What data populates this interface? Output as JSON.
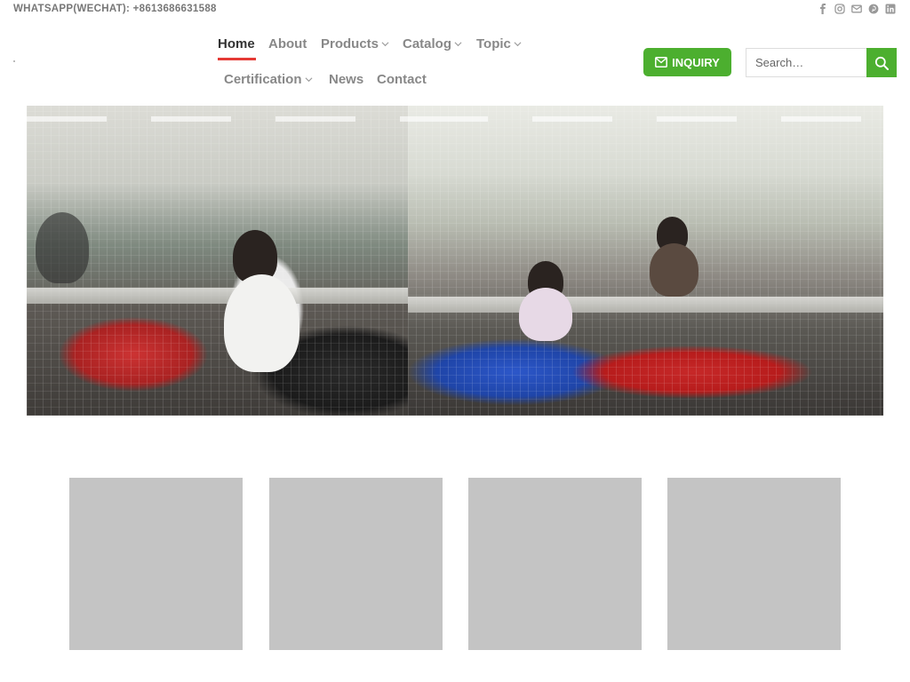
{
  "topbar": {
    "contact": "WHATSAPP(WECHAT): +8613686631588"
  },
  "social_icons": [
    "facebook-icon",
    "instagram-icon",
    "email-icon",
    "pinterest-icon",
    "linkedin-icon"
  ],
  "nav": {
    "items": [
      {
        "label": "Home",
        "active": true,
        "dropdown": false
      },
      {
        "label": "About",
        "active": false,
        "dropdown": false
      },
      {
        "label": "Products",
        "active": false,
        "dropdown": true
      },
      {
        "label": "Catalog",
        "active": false,
        "dropdown": true
      },
      {
        "label": "Topic",
        "active": false,
        "dropdown": true
      },
      {
        "label": "Certification",
        "active": false,
        "dropdown": true
      },
      {
        "label": "News",
        "active": false,
        "dropdown": false
      },
      {
        "label": "Contact",
        "active": false,
        "dropdown": false
      }
    ]
  },
  "inquiry": {
    "label": "INQUIRY",
    "icon": "envelope-icon"
  },
  "search": {
    "placeholder": "Search…",
    "icon": "search-icon"
  },
  "colors": {
    "accent_green": "#4caf2f",
    "active_red": "#e53935",
    "placeholder_gray": "#c4c4c4"
  }
}
